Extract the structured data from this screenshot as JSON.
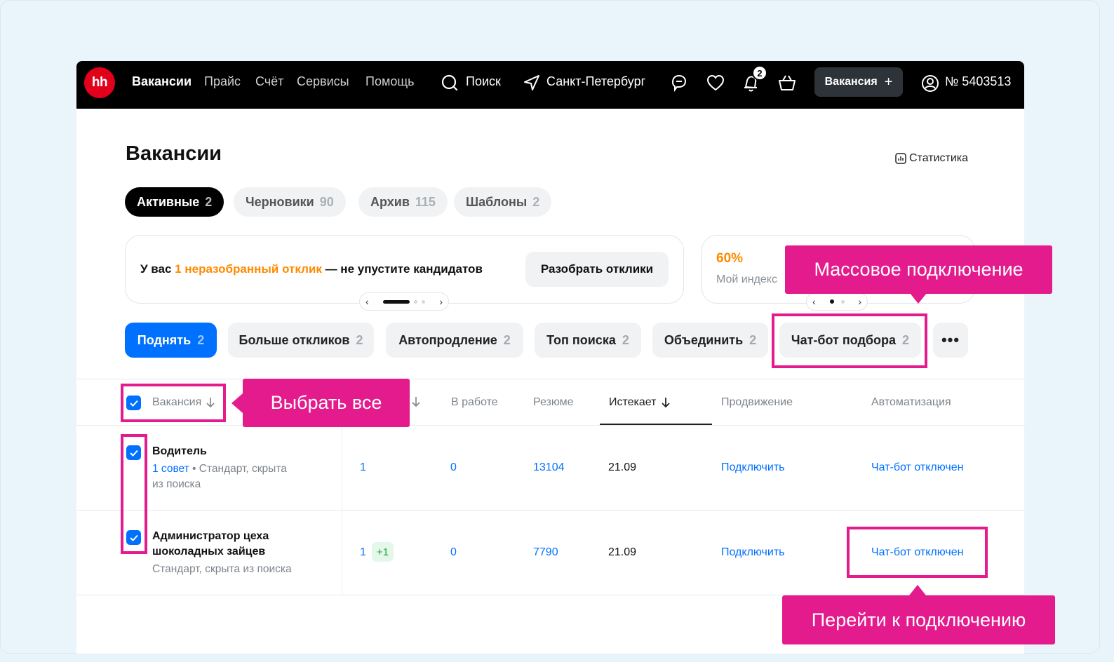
{
  "header": {
    "logo": "hh",
    "nav": [
      "Вакансии",
      "Прайс",
      "Счёт",
      "Сервисы",
      "Помощь"
    ],
    "search_label": "Поиск",
    "city": "Санкт-Петербург",
    "notifications_count": "2",
    "vacancy_button": "Вакансия",
    "account": "№ 5403513"
  },
  "page": {
    "title": "Вакансии",
    "stats_link": "Статистика",
    "tabs": [
      {
        "label": "Активные",
        "count": "2"
      },
      {
        "label": "Черновики",
        "count": "90"
      },
      {
        "label": "Архив",
        "count": "115"
      },
      {
        "label": "Шаблоны",
        "count": "2"
      }
    ]
  },
  "banner": {
    "prefix": "У вас ",
    "highlight": "1 неразобранный отклик",
    "suffix": " — не упустите кандидатов",
    "button": "Разобрать отклики",
    "percent": "60%",
    "index_label": "Мой индекс"
  },
  "actions": [
    {
      "label": "Поднять",
      "count": "2"
    },
    {
      "label": "Больше откликов",
      "count": "2"
    },
    {
      "label": "Автопродление",
      "count": "2"
    },
    {
      "label": "Топ поиска",
      "count": "2"
    },
    {
      "label": "Объединить",
      "count": "2"
    },
    {
      "label": "Чат-бот подбора",
      "count": "2"
    }
  ],
  "table": {
    "headers": {
      "vacancy": "Вакансия",
      "in_work": "В работе",
      "resume": "Резюме",
      "expires": "Истекает",
      "promotion": "Продвижение",
      "automation": "Автоматизация"
    },
    "rows": [
      {
        "title": "Водитель",
        "tip": "1 совет",
        "meta_after_tip": " • Стандарт, скрыта",
        "meta_line2": "из поиска",
        "responses": "1",
        "in_work": "0",
        "resume": "13104",
        "expires": "21.09",
        "promotion": "Подключить",
        "automation": "Чат-бот отключен"
      },
      {
        "title_line1": "Администратор цеха",
        "title_line2": "шоколадных зайцев",
        "meta": "Стандарт, скрыта из поиска",
        "responses": "1",
        "responses_new": "+1",
        "in_work": "0",
        "resume": "7790",
        "expires": "21.09",
        "promotion": "Подключить",
        "automation": "Чат-бот отключен"
      }
    ]
  },
  "annotations": {
    "mass_connect": "Массовое подключение",
    "select_all": "Выбрать все",
    "go_to_connect": "Перейти к подключению"
  },
  "colors": {
    "accent_blue": "#0070ff",
    "brand_red": "#e3001b",
    "annotation_pink": "#e31b8c",
    "highlight_orange": "#ff8a00"
  }
}
